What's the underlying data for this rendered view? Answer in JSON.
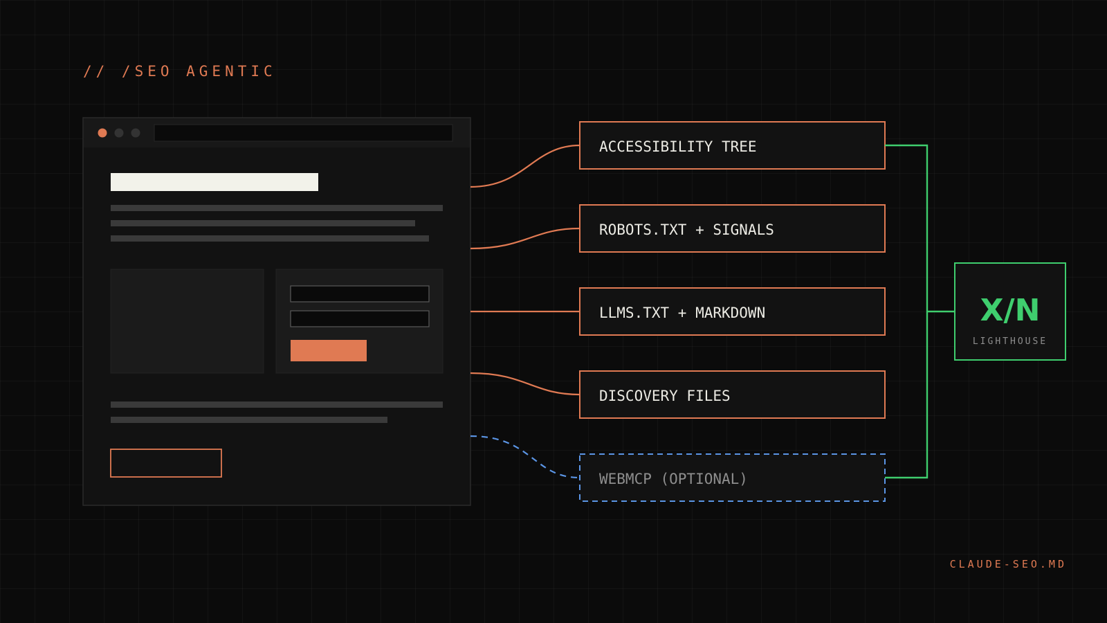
{
  "header": {
    "label": "// /SEO AGENTIC"
  },
  "nodes": [
    {
      "id": "accessibility",
      "label": "ACCESSIBILITY TREE",
      "optional": false
    },
    {
      "id": "robots",
      "label": "ROBOTS.TXT + SIGNALS",
      "optional": false
    },
    {
      "id": "llms",
      "label": "LLMS.TXT + MARKDOWN",
      "optional": false
    },
    {
      "id": "discovery",
      "label": "DISCOVERY FILES",
      "optional": false
    },
    {
      "id": "webmcp",
      "label": "WEBMCP (OPTIONAL)",
      "optional": true
    }
  ],
  "score": {
    "value": "X/N",
    "label": "LIGHTHOUSE"
  },
  "footer": {
    "label": "CLAUDE-SEO.MD"
  },
  "colors": {
    "background": "#0b0b0b",
    "accent_orange": "#e07a53",
    "accent_green": "#3fce6e",
    "accent_blue": "#5b95e5",
    "panel": "#141414",
    "text_light": "#ecebe4",
    "text_muted": "#8e8e8e"
  }
}
